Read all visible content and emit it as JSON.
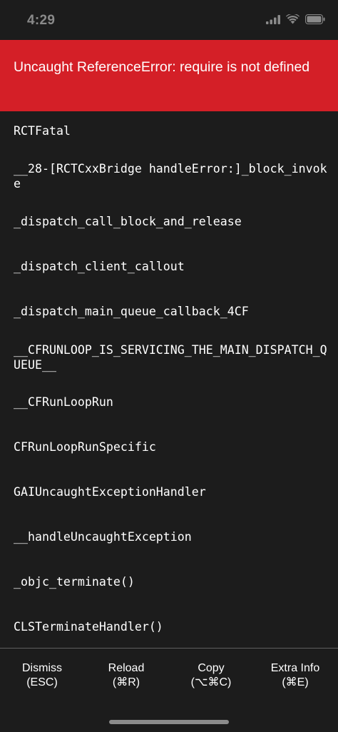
{
  "status_bar": {
    "time": "4:29",
    "icons": [
      "signal-icon",
      "wifi-icon",
      "battery-icon"
    ]
  },
  "error": {
    "title": "Uncaught ReferenceError: require is not defined",
    "background_color": "#d41f27"
  },
  "stack": [
    "RCTFatal",
    "__28-[RCTCxxBridge handleError:]_block_invoke",
    "_dispatch_call_block_and_release",
    "_dispatch_client_callout",
    "_dispatch_main_queue_callback_4CF",
    "__CFRUNLOOP_IS_SERVICING_THE_MAIN_DISPATCH_QUEUE__",
    "__CFRunLoopRun",
    "CFRunLoopRunSpecific",
    "GAIUncaughtExceptionHandler",
    "__handleUncaughtException",
    "_objc_terminate()",
    "CLSTerminateHandler()"
  ],
  "toolbar": {
    "dismiss": {
      "label": "Dismiss",
      "shortcut": "(ESC)"
    },
    "reload": {
      "label": "Reload",
      "shortcut": "(⌘R)"
    },
    "copy": {
      "label": "Copy",
      "shortcut": "(⌥⌘C)"
    },
    "extra": {
      "label": "Extra Info",
      "shortcut": "(⌘E)"
    }
  }
}
